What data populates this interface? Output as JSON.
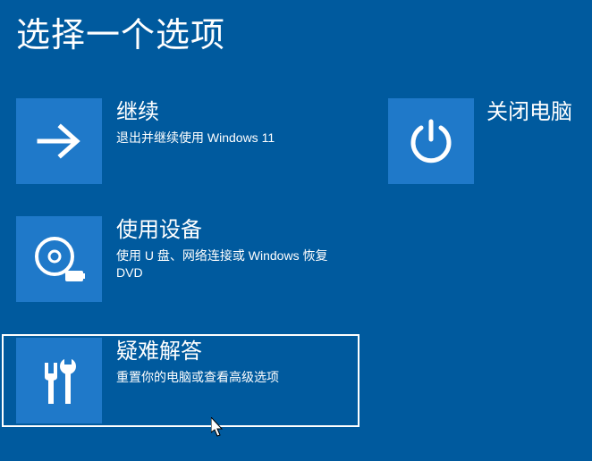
{
  "page_title": "选择一个选项",
  "options": {
    "continue": {
      "title": "继续",
      "desc": "退出并继续使用 Windows 11"
    },
    "use_device": {
      "title": "使用设备",
      "desc": "使用 U 盘、网络连接或 Windows 恢复 DVD"
    },
    "troubleshoot": {
      "title": "疑难解答",
      "desc": "重置你的电脑或查看高级选项"
    },
    "shutdown": {
      "title": "关闭电脑"
    }
  }
}
